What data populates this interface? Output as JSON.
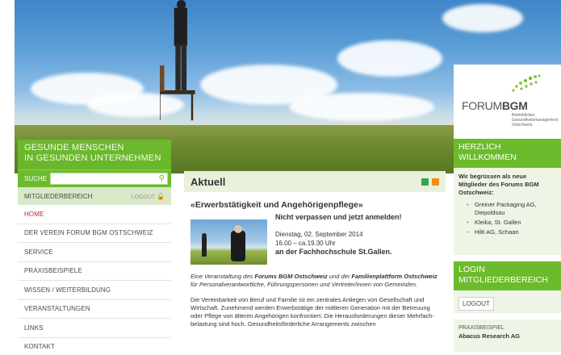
{
  "left": {
    "heading_line1": "GESUNDE MENSCHEN",
    "heading_line2": "IN GESUNDEN UNTERNEHMEN",
    "search_label": "SUCHE",
    "search_placeholder": "",
    "members_label": "MITGLIEDERBEREICH",
    "members_logout": "LOGOUT",
    "nav": [
      {
        "label": "HOME"
      },
      {
        "label": "DER VEREIN FORUM BGM OSTSCHWEIZ"
      },
      {
        "label": "SERVICE"
      },
      {
        "label": "PRAXISBEISPIELE"
      },
      {
        "label": "WISSEN / WEITERBILDUNG"
      },
      {
        "label": "VERANSTALTUNGEN"
      },
      {
        "label": "LINKS"
      },
      {
        "label": "KONTAKT"
      }
    ]
  },
  "main": {
    "title": "Aktuell",
    "headline": "«Erwerbstätigkeit und Angehörigenpflege»",
    "teaser_cta": "Nicht verpassen und jetzt anmelden!",
    "date": "Dienstag, 02. September 2014",
    "time": "16.00 – ca.19.30 Uhr",
    "location": "an der Fachhochschule St.Gallen.",
    "intro_1": "Eine Veranstaltung des ",
    "intro_org1": "Forums BGM Ostschweiz",
    "intro_2": " und der ",
    "intro_org2": "Familienplattform Ostschweiz",
    "intro_3": " für Personalverantwortliche, Führungspersonen und Vertreter/innen von Gemeinden.",
    "paragraph": "Die Vereinbarkeit von Beruf und Familie ist ein zentrales Anliegen von Gesellschaft und Wirtschaft. Zunehmend werden Erwerbstätige der mittleren Generation mit der Betreuung oder Pflege von älteren Angehörigen konfrontiert. Die Herausforderungen dieser Mehrfach-belastung sind hoch. Gesundheitsförderliche Arrangements zwischen"
  },
  "right": {
    "logo_forum": "FORUM",
    "logo_bgm": "BGM",
    "logo_sub_1": "Betriebliches",
    "logo_sub_2": "Gesundheitsmanagement",
    "logo_sub_3": "Ostschweiz",
    "welcome_line1": "HERZLICH",
    "welcome_line2": "WILLKOMMEN",
    "welcome_intro": "Wir begrüssen als neue Mitglieder des Forums BGM Ostschweiz:",
    "members": [
      {
        "name": "Greiner Packaging AG, Diepoldsau"
      },
      {
        "name": "Kleika, St. Gallen"
      },
      {
        "name": "Hilti AG, Schaan"
      }
    ],
    "login_line1": "LOGIN",
    "login_line2": "MITGLIEDERBEREICH",
    "logout_button": "LOGOUT",
    "practice_label": "PRAXISBEISPIEL",
    "practice_company": "Abacus Research AG"
  },
  "colors": {
    "green": "#6cbb2c",
    "light_green": "#eef5e6",
    "active_red": "#c0282d"
  }
}
